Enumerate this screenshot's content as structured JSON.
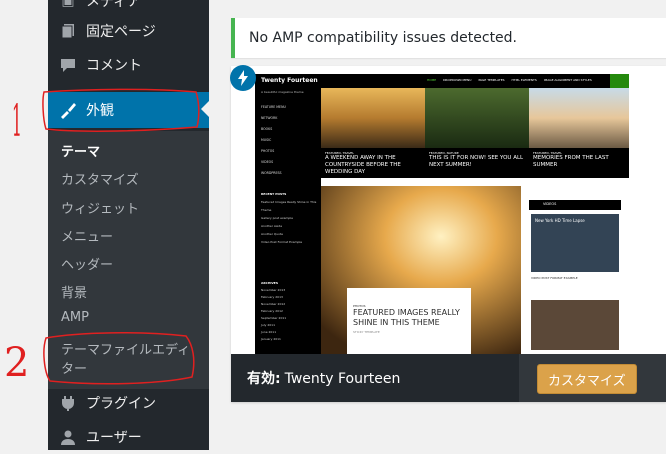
{
  "sidebar": {
    "top_partial": "メディア",
    "items": [
      {
        "label": "固定ページ",
        "icon": "pages-icon"
      },
      {
        "label": "コメント",
        "icon": "comment-icon"
      },
      {
        "label": "外観",
        "icon": "appearance-icon"
      },
      {
        "label": "プラグイン",
        "icon": "plugin-icon"
      },
      {
        "label": "ユーザー",
        "icon": "users-icon"
      }
    ],
    "submenu": [
      {
        "label": "テーマ",
        "current": true
      },
      {
        "label": "カスタマイズ"
      },
      {
        "label": "ウィジェット"
      },
      {
        "label": "メニュー"
      },
      {
        "label": "ヘッダー"
      },
      {
        "label": "背景"
      },
      {
        "label": "AMP"
      },
      {
        "label": "テーマファイルエディ"
      },
      {
        "label": "ター"
      }
    ]
  },
  "notice": {
    "text": "No AMP compatibility issues detected."
  },
  "theme_card": {
    "active_label": "有効:",
    "theme_name": "Twenty Fourteen",
    "customize_button": "カスタマイズ"
  },
  "preview": {
    "site_title": "Twenty Fourteen",
    "tagline": "A beautiful magazine theme",
    "nav": [
      "HOME",
      "DROPDOWN MENU",
      "PAGE TEMPLATES",
      "HTML ELEMENTS",
      "IMAGE ALIGNMENT AND STYLES"
    ],
    "side_menu": [
      "FEATURE MENU",
      "NETWORK",
      "BOOKS",
      "MUSIC",
      "PHOTOS",
      "VIDEOS",
      "WORDPRESS"
    ],
    "featured": [
      {
        "cat": "FEATURED, TRAVEL",
        "title": "A WEEKEND AWAY IN THE COUNTRYSIDE BEFORE THE WEDDING DAY"
      },
      {
        "cat": "FEATURED, NATURE",
        "title": "THIS IS IT FOR NOW! SEE YOU ALL NEXT SUMMER!"
      },
      {
        "cat": "FEATURED, TRAVEL",
        "title": "MEMORIES FROM THE LAST SUMMER"
      }
    ],
    "recent_heading": "RECENT POSTS",
    "recent_posts": [
      "Featured Images Really Shine in This Theme",
      "Gallery post example",
      "Another Aside",
      "Another Quote",
      "Video Post Format Example"
    ],
    "archives_heading": "ARCHIVES",
    "archives": [
      "November 2013",
      "February 2013",
      "November 2012",
      "February 2012",
      "September 2011",
      "July 2011",
      "June 2011",
      "January 2011"
    ],
    "main_post": {
      "cat": "PHOTOS",
      "title": "FEATURED IMAGES REALLY SHINE IN THIS THEME",
      "meta": "STICKY   TEMPLATE"
    },
    "videos_label": "VIDEOS",
    "video_title": "New York HD Time Lapse",
    "video_caption": "VIDEO POST FORMAT EXAMPLE"
  },
  "annotations": {
    "one": "1",
    "two": "2"
  },
  "colors": {
    "sidebar": "#23282d",
    "active": "#0073aa",
    "notice_border": "#46b450",
    "customize": "#dba24a",
    "annotation": "#e02020"
  }
}
